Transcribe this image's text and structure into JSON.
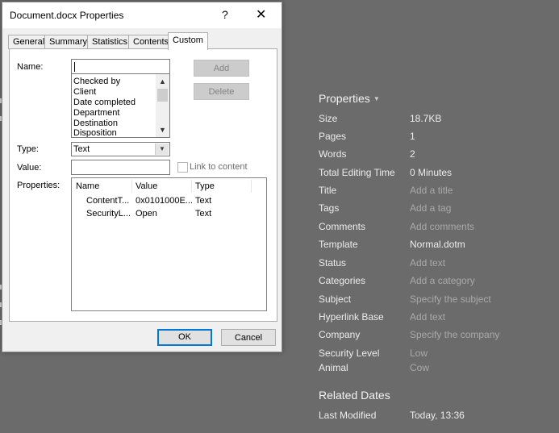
{
  "background_pane": {
    "heading": "Properties",
    "properties": [
      {
        "label": "Size",
        "value": "18.7KB",
        "placeholder": false
      },
      {
        "label": "Pages",
        "value": "1",
        "placeholder": false
      },
      {
        "label": "Words",
        "value": "2",
        "placeholder": false
      },
      {
        "label": "Total Editing Time",
        "value": "0 Minutes",
        "placeholder": false
      },
      {
        "label": "Title",
        "value": "Add a title",
        "placeholder": true
      },
      {
        "label": "Tags",
        "value": "Add a tag",
        "placeholder": true
      },
      {
        "label": "Comments",
        "value": "Add comments",
        "placeholder": true
      },
      {
        "label": "Template",
        "value": "Normal.dotm",
        "placeholder": false
      },
      {
        "label": "Status",
        "value": "Add text",
        "placeholder": true
      },
      {
        "label": "Categories",
        "value": "Add a category",
        "placeholder": true
      },
      {
        "label": "Subject",
        "value": "Specify the subject",
        "placeholder": true
      },
      {
        "label": "Hyperlink Base",
        "value": "Add text",
        "placeholder": true
      },
      {
        "label": "Company",
        "value": "Specify the company",
        "placeholder": true
      },
      {
        "label": "Security Level",
        "value": "Low",
        "placeholder": false
      },
      {
        "label": "Animal",
        "value": "Cow",
        "placeholder": false
      }
    ],
    "related_dates_heading": "Related Dates",
    "dates": [
      {
        "label": "Last Modified",
        "value": "Today, 13:36"
      }
    ]
  },
  "dialog": {
    "title": "Document.docx Properties",
    "help_label": "?",
    "close_label": "✕",
    "tabs": [
      "General",
      "Summary",
      "Statistics",
      "Contents",
      "Custom"
    ],
    "active_tab": "Custom",
    "name_label": "Name:",
    "name_value": "",
    "name_options": [
      "Checked by",
      "Client",
      "Date completed",
      "Department",
      "Destination",
      "Disposition"
    ],
    "add_button": "Add",
    "delete_button": "Delete",
    "type_label": "Type:",
    "type_value": "Text",
    "value_label": "Value:",
    "value_value": "",
    "link_to_content_label": "Link to content",
    "properties_label": "Properties:",
    "columns": [
      "Name",
      "Value",
      "Type"
    ],
    "rows": [
      {
        "name": "ContentT...",
        "value": "0x0101000E...",
        "type": "Text"
      },
      {
        "name": "SecurityL...",
        "value": "Open",
        "type": "Text"
      }
    ],
    "ok_button": "OK",
    "cancel_button": "Cancel"
  },
  "colors": {
    "background": "#6b6b6b",
    "accent": "#0078d7",
    "placeholder_text": "#a9a9a9"
  }
}
